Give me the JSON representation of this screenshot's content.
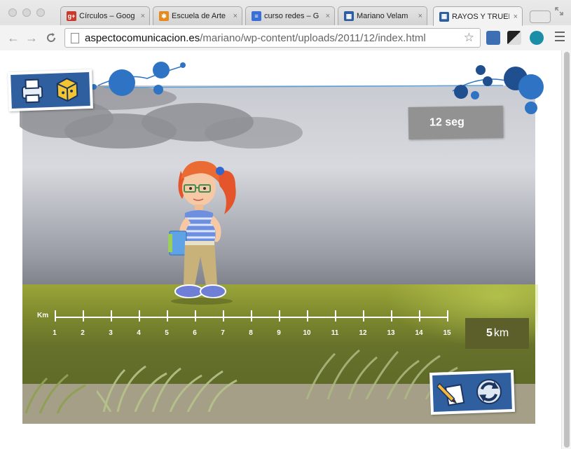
{
  "browser": {
    "tabs": [
      {
        "title": "Círculos – Goog",
        "favicon": "google-plus-icon",
        "color": "#c9392c",
        "active": false
      },
      {
        "title": "Escuela de Arte",
        "favicon": "joomla-icon",
        "color": "#e68a1e",
        "active": false
      },
      {
        "title": "curso redes – G",
        "favicon": "docs-icon",
        "color": "#3a6fd8",
        "active": false
      },
      {
        "title": "Mariano Velam",
        "favicon": "blog-icon",
        "color": "#2f5da3",
        "active": false
      },
      {
        "title": "RAYOS Y TRUEN",
        "favicon": "blog-icon",
        "color": "#2f5da3",
        "active": true
      }
    ],
    "url_host": "aspectocomunicacion.es",
    "url_path": "/mariano/wp-content/uploads/2011/12/index.html",
    "close_glyph": "×"
  },
  "game": {
    "timer_value": "12",
    "timer_unit": "seg",
    "ruler_label": "Km",
    "ruler_ticks": [
      "1",
      "2",
      "3",
      "4",
      "5",
      "6",
      "7",
      "8",
      "9",
      "10",
      "11",
      "12",
      "13",
      "14",
      "15"
    ],
    "distance_value": "5",
    "distance_unit": "km",
    "colors": {
      "panel_blue": "#2f5f9e",
      "bubble_blue": "#2f74c4",
      "timer_gray": "#929292"
    }
  }
}
